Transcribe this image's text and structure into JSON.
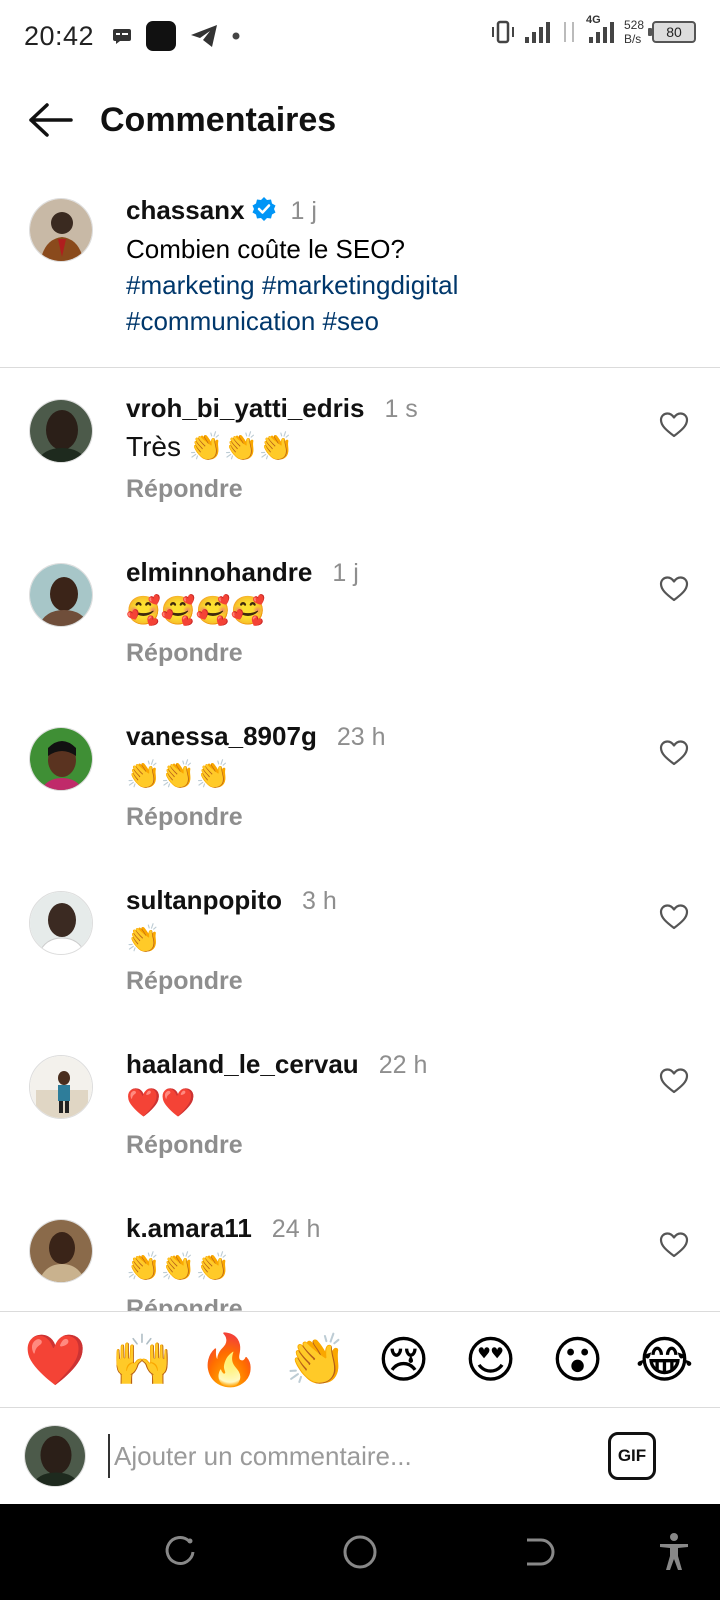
{
  "status": {
    "time": "20:42",
    "network_type": "4G",
    "speed_value": "528",
    "speed_unit": "B/s",
    "battery": "80"
  },
  "header": {
    "title": "Commentaires"
  },
  "caption": {
    "username": "chassanx",
    "time": "1 j",
    "text": "Combien coûte le SEO?",
    "hashtags": [
      "#marketing",
      "#marketingdigital",
      "#communication",
      "#seo"
    ]
  },
  "comments": [
    {
      "username": "vroh_bi_yatti_edris",
      "time": "1 s",
      "text": "Très 👏👏👏",
      "reply": "Répondre"
    },
    {
      "username": "elminnohandre",
      "time": "1 j",
      "text": "🥰🥰🥰🥰",
      "reply": "Répondre"
    },
    {
      "username": "vanessa_8907g",
      "time": "23 h",
      "text": "👏👏👏",
      "reply": "Répondre"
    },
    {
      "username": "sultanpopito",
      "time": "3 h",
      "text": "👏",
      "reply": "Répondre"
    },
    {
      "username": "haaland_le_cervau",
      "time": "22 h",
      "text": "❤️❤️",
      "reply": "Répondre"
    },
    {
      "username": "k.amara11",
      "time": "24 h",
      "text": "👏👏👏",
      "reply": "Répondre"
    }
  ],
  "reactions": [
    "❤️",
    "🙌",
    "🔥",
    "👏",
    "😢",
    "😍",
    "😮",
    "😂"
  ],
  "composer": {
    "placeholder": "Ajouter un commentaire...",
    "gif_label": "GIF"
  },
  "colors": {
    "hashtag": "#00376b",
    "verified": "#0095f6",
    "muted": "#8e8e8e"
  }
}
